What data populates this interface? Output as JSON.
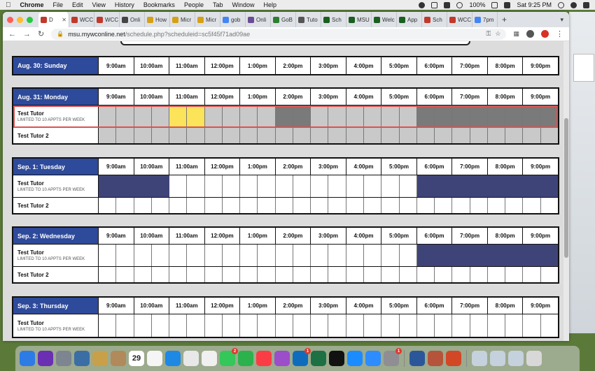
{
  "menubar": {
    "app": "Chrome",
    "items": [
      "File",
      "Edit",
      "View",
      "History",
      "Bookmarks",
      "People",
      "Tab",
      "Window",
      "Help"
    ],
    "battery": "100%",
    "clock": "Sat 9:25 PM"
  },
  "tabs": [
    {
      "label": "D",
      "active": true,
      "color": "#c0392b"
    },
    {
      "label": "WCC",
      "color": "#c0392b"
    },
    {
      "label": "WCC",
      "color": "#c0392b"
    },
    {
      "label": "Onli",
      "color": "#444444"
    },
    {
      "label": "How",
      "color": "#d4a017"
    },
    {
      "label": "Micr",
      "color": "#d4a017"
    },
    {
      "label": "Micr",
      "color": "#d4a017"
    },
    {
      "label": "gob",
      "color": "#4285f4"
    },
    {
      "label": "Onli",
      "color": "#6a4c93"
    },
    {
      "label": "GoB",
      "color": "#2e7d32"
    },
    {
      "label": "Tuto",
      "color": "#555555"
    },
    {
      "label": "Sch",
      "color": "#1b5e20"
    },
    {
      "label": "MSU",
      "color": "#1b5e20"
    },
    {
      "label": "Welc",
      "color": "#1b5e20"
    },
    {
      "label": "App",
      "color": "#1b5e20"
    },
    {
      "label": "Sch",
      "color": "#c0392b"
    },
    {
      "label": "WCC",
      "color": "#c0392b"
    },
    {
      "label": "7pm",
      "color": "#4285f4"
    }
  ],
  "address": {
    "host": "msu.mywconline.net",
    "path": "/schedule.php?scheduleid=sc5f45f71ad09ae"
  },
  "times": [
    "9:00am",
    "10:00am",
    "11:00am",
    "12:00pm",
    "1:00pm",
    "2:00pm",
    "3:00pm",
    "4:00pm",
    "5:00pm",
    "6:00pm",
    "7:00pm",
    "8:00pm",
    "9:00pm"
  ],
  "days": [
    {
      "date": "Aug. 30:",
      "weekday": "Sunday",
      "rows": []
    },
    {
      "date": "Aug. 31:",
      "weekday": "Monday",
      "rows": [
        {
          "name": "Test Tutor",
          "limit": "LIMITED TO 10 APPTS PER WEEK",
          "selected": true,
          "slots": [
            "grey",
            "grey",
            "grey",
            "grey",
            "yellow",
            "yellow",
            "grey",
            "grey",
            "grey",
            "grey",
            "dark",
            "dark",
            "grey",
            "grey",
            "grey",
            "grey",
            "grey",
            "grey",
            "dark",
            "dark",
            "dark",
            "dark",
            "dark",
            "dark",
            "dark",
            "dark"
          ]
        },
        {
          "name": "Test Tutor 2",
          "limit": "",
          "slots": [
            "grey",
            "grey",
            "grey",
            "grey",
            "grey",
            "grey",
            "grey",
            "grey",
            "grey",
            "grey",
            "grey",
            "grey",
            "grey",
            "grey",
            "grey",
            "grey",
            "grey",
            "grey",
            "grey",
            "grey",
            "grey",
            "grey",
            "grey",
            "grey",
            "grey",
            "grey"
          ]
        }
      ]
    },
    {
      "date": "Sep. 1:",
      "weekday": "Tuesday",
      "rows": [
        {
          "name": "Test Tutor",
          "limit": "LIMITED TO 10 APPTS PER WEEK",
          "slots": [
            "navy",
            "navy",
            "navy",
            "navy",
            "white",
            "white",
            "white",
            "white",
            "white",
            "white",
            "white",
            "white",
            "white",
            "white",
            "white",
            "white",
            "white",
            "white",
            "navy",
            "navy",
            "navy",
            "navy",
            "navy",
            "navy",
            "navy",
            "navy"
          ]
        },
        {
          "name": "Test Tutor 2",
          "limit": "",
          "slots": [
            "white",
            "white",
            "white",
            "white",
            "white",
            "white",
            "white",
            "white",
            "white",
            "white",
            "white",
            "white",
            "white",
            "white",
            "white",
            "white",
            "white",
            "white",
            "white",
            "white",
            "white",
            "white",
            "white",
            "white",
            "white",
            "white"
          ]
        }
      ]
    },
    {
      "date": "Sep. 2:",
      "weekday": "Wednesday",
      "rows": [
        {
          "name": "Test Tutor",
          "limit": "LIMITED TO 10 APPTS PER WEEK",
          "slots": [
            "white",
            "white",
            "white",
            "white",
            "white",
            "white",
            "white",
            "white",
            "white",
            "white",
            "white",
            "white",
            "white",
            "white",
            "white",
            "white",
            "white",
            "white",
            "navy",
            "navy",
            "navy",
            "navy",
            "navy",
            "navy",
            "navy",
            "navy"
          ]
        },
        {
          "name": "Test Tutor 2",
          "limit": "",
          "slots": [
            "white",
            "white",
            "white",
            "white",
            "white",
            "white",
            "white",
            "white",
            "white",
            "white",
            "white",
            "white",
            "white",
            "white",
            "white",
            "white",
            "white",
            "white",
            "white",
            "white",
            "white",
            "white",
            "white",
            "white",
            "white",
            "white"
          ]
        }
      ]
    },
    {
      "date": "Sep. 3:",
      "weekday": "Thursday",
      "rows": [
        {
          "name": "Test Tutor",
          "limit": "LIMITED TO 10 APPTS PER WEEK",
          "slots": [
            "white",
            "white",
            "white",
            "white",
            "white",
            "white",
            "white",
            "white",
            "white",
            "white",
            "white",
            "white",
            "white",
            "white",
            "white",
            "white",
            "white",
            "white",
            "white",
            "white",
            "white",
            "white",
            "white",
            "white",
            "white",
            "white"
          ]
        }
      ]
    }
  ],
  "dock": {
    "calendar_day": "29",
    "apps": [
      {
        "name": "finder-icon",
        "color": "#2d7be5"
      },
      {
        "name": "siri-icon",
        "color": "#6b2fb3"
      },
      {
        "name": "launchpad-icon",
        "color": "#7d8590"
      },
      {
        "name": "preview-icon",
        "color": "#3a6ea5"
      },
      {
        "name": "notes-icon",
        "color": "#c8a04a"
      },
      {
        "name": "contacts-icon",
        "color": "#b08a5a"
      },
      {
        "name": "calendar-icon",
        "color": "#ffffff"
      },
      {
        "name": "reminders-icon",
        "color": "#f5f5f5"
      },
      {
        "name": "safari-icon",
        "color": "#1e88e5"
      },
      {
        "name": "chrome-icon",
        "color": "#e8e8e8"
      },
      {
        "name": "photos-icon",
        "color": "#f0f0f0"
      },
      {
        "name": "messages-icon",
        "color": "#34c759",
        "badge": "2"
      },
      {
        "name": "facetime-icon",
        "color": "#2bb24c"
      },
      {
        "name": "music-icon",
        "color": "#fc3c44"
      },
      {
        "name": "podcasts-icon",
        "color": "#9b4dca"
      },
      {
        "name": "outlook-icon",
        "color": "#0f6cbd",
        "badge": "1"
      },
      {
        "name": "excel-icon",
        "color": "#1d7044"
      },
      {
        "name": "tv-icon",
        "color": "#111111"
      },
      {
        "name": "appstore-icon",
        "color": "#1a8cff"
      },
      {
        "name": "zoom-icon",
        "color": "#2d8cff"
      },
      {
        "name": "system-preferences-icon",
        "color": "#8e8e93",
        "badge": "1"
      },
      {
        "name": "word-icon",
        "color": "#2b579a"
      },
      {
        "name": "photo-booth-icon",
        "color": "#b5543a"
      },
      {
        "name": "powerpoint-icon",
        "color": "#d24726"
      },
      {
        "name": "folder-icon",
        "color": "#c5d1dc"
      },
      {
        "name": "folder-icon-2",
        "color": "#c5d1dc"
      },
      {
        "name": "folder-icon-3",
        "color": "#c5d1dc"
      },
      {
        "name": "trash-icon",
        "color": "#d8d8d8"
      }
    ]
  }
}
